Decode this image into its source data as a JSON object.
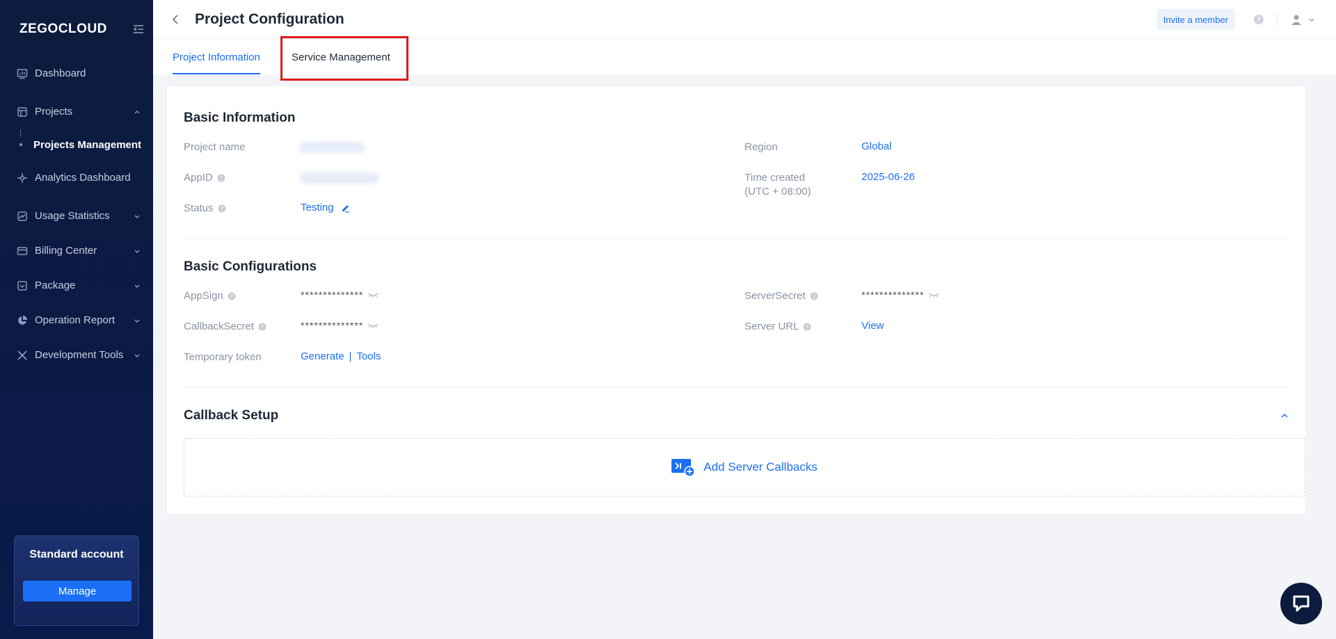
{
  "sidebar": {
    "logo": "ZEGOCLOUD",
    "items": [
      {
        "label": "Dashboard"
      },
      {
        "label": "Projects"
      },
      {
        "label": "Projects Management"
      },
      {
        "label": "Analytics Dashboard"
      },
      {
        "label": "Usage Statistics"
      },
      {
        "label": "Billing Center"
      },
      {
        "label": "Package"
      },
      {
        "label": "Operation Report"
      },
      {
        "label": "Development Tools"
      }
    ],
    "account": {
      "title": "Standard account",
      "button": "Manage"
    }
  },
  "header": {
    "title": "Project Configuration",
    "invite": "Invite a member"
  },
  "tabs": [
    {
      "label": "Project Information"
    },
    {
      "label": "Service Management"
    }
  ],
  "basic_info": {
    "title": "Basic Information",
    "project_name_label": "Project name",
    "appid_label": "AppID",
    "status_label": "Status",
    "status_value": "Testing",
    "region_label": "Region",
    "region_value": "Global",
    "time_label_1": "Time created",
    "time_label_2": "(UTC + 08:00)",
    "time_value": "2025-06-26"
  },
  "basic_config": {
    "title": "Basic Configurations",
    "appsign_label": "AppSign",
    "appsign_value": "**************",
    "callback_label": "CallbackSecret",
    "callback_value": "**************",
    "token_label": "Temporary token",
    "generate": "Generate",
    "tools": "Tools",
    "serversecret_label": "ServerSecret",
    "serversecret_value": "**************",
    "serverurl_label": "Server URL",
    "serverurl_value": "View"
  },
  "callback": {
    "title": "Callback Setup",
    "add_label": "Add Server Callbacks"
  },
  "colors": {
    "accent": "#1c6ff5",
    "sidebar_bg": "#0d1b3e",
    "highlight": "#e21a1a"
  }
}
